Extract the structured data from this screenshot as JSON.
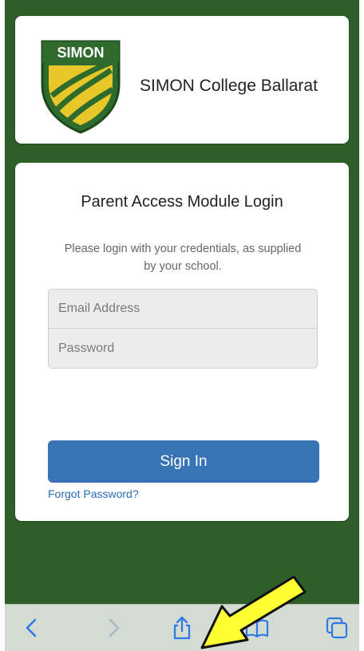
{
  "school": {
    "name": "SIMON College Ballarat",
    "logo_text": "SIMON"
  },
  "login": {
    "title": "Parent Access Module Login",
    "subtitle": "Please login with your credentials, as supplied by your school.",
    "email_placeholder": "Email Address",
    "password_placeholder": "Password",
    "signin_label": "Sign In",
    "forgot_label": "Forgot Password?"
  },
  "toolbar": {
    "icons": [
      "back-icon",
      "forward-icon",
      "share-icon",
      "bookmarks-icon",
      "tabs-icon"
    ]
  },
  "colors": {
    "background": "#2e5f2a",
    "primary_button": "#3773b5",
    "link": "#2a6db4",
    "annotation_arrow": "#ffff33"
  }
}
